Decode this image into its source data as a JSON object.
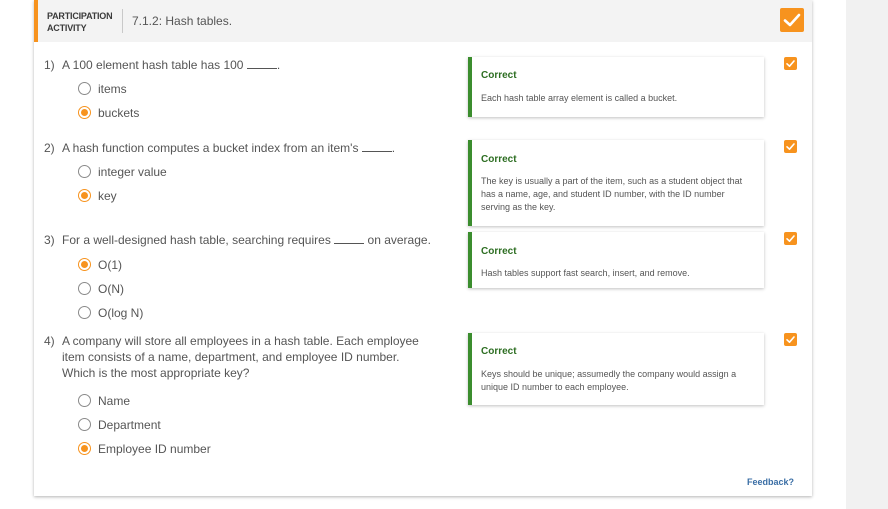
{
  "header": {
    "label_line1": "PARTICIPATION",
    "label_line2": "ACTIVITY",
    "title": "7.1.2: Hash tables."
  },
  "questions": [
    {
      "number": "1)",
      "text_before": "A 100 element hash table has 100",
      "text_after": ".",
      "options": [
        {
          "label": "items",
          "selected": false
        },
        {
          "label": "buckets",
          "selected": true
        }
      ],
      "feedback": {
        "title": "Correct",
        "text": "Each hash table array element is called a bucket."
      }
    },
    {
      "number": "2)",
      "text_before": "A hash function computes a bucket index from an item's",
      "text_after": ".",
      "options": [
        {
          "label": "integer value",
          "selected": false
        },
        {
          "label": "key",
          "selected": true
        }
      ],
      "feedback": {
        "title": "Correct",
        "text": "The key is usually a part of the item, such as a student object that has a name, age, and student ID number, with the ID number serving as the key."
      }
    },
    {
      "number": "3)",
      "text_before": "For a well-designed hash table, searching requires",
      "text_after": "on average.",
      "options": [
        {
          "label": "O(1)",
          "selected": true
        },
        {
          "label": "O(N)",
          "selected": false
        },
        {
          "label": "O(log N)",
          "selected": false
        }
      ],
      "feedback": {
        "title": "Correct",
        "text": "Hash tables support fast search, insert, and remove."
      }
    },
    {
      "number": "4)",
      "text": "A company will store all employees in a hash table. Each employee item consists of a name, department, and employee ID number. Which is the most appropriate key?",
      "options": [
        {
          "label": "Name",
          "selected": false
        },
        {
          "label": "Department",
          "selected": false
        },
        {
          "label": "Employee ID number",
          "selected": true
        }
      ],
      "feedback": {
        "title": "Correct",
        "text": "Keys should be unique; assumedly the company would assign a unique ID number to each employee."
      }
    }
  ],
  "footer": {
    "feedback_link": "Feedback?"
  },
  "colors": {
    "accent": "#f7931e",
    "correct": "#3b8d2e"
  },
  "icons": {
    "check": "check-icon"
  }
}
